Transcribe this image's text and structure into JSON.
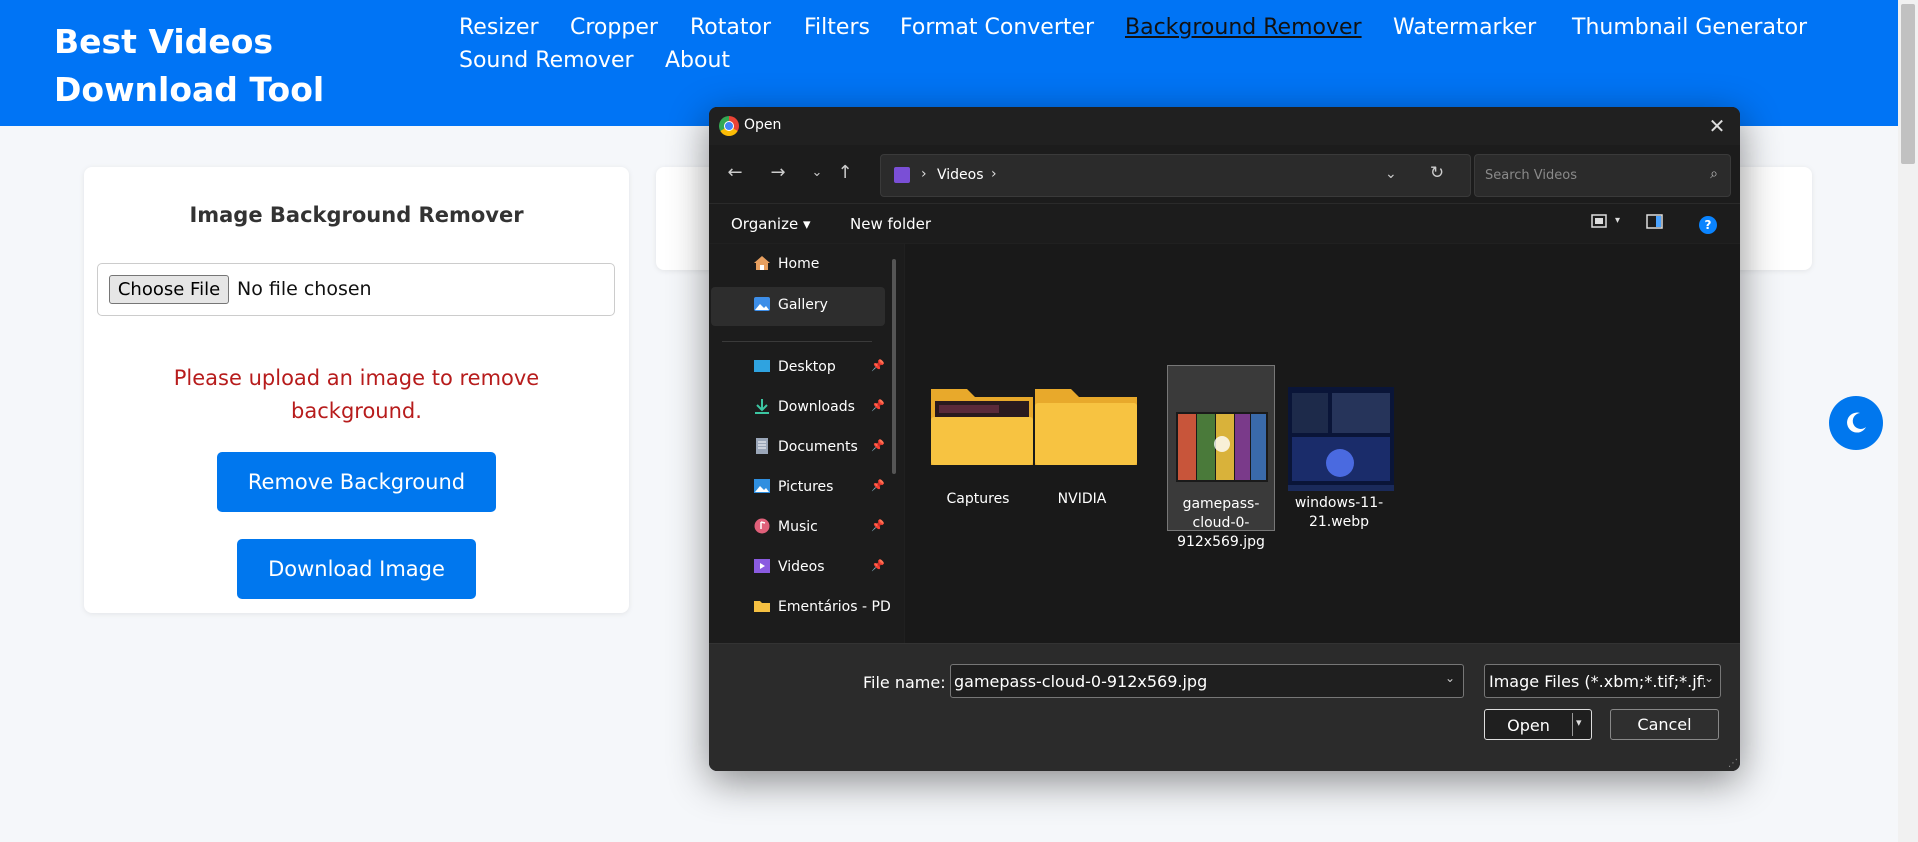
{
  "header": {
    "brand": "Best Videos Download Tool",
    "nav": [
      {
        "label": "Resizer",
        "active": false
      },
      {
        "label": "Cropper",
        "active": false
      },
      {
        "label": "Rotator",
        "active": false
      },
      {
        "label": "Filters",
        "active": false
      },
      {
        "label": "Format Converter",
        "active": false
      },
      {
        "label": "Background Remover",
        "active": true
      },
      {
        "label": "Watermarker",
        "active": false
      },
      {
        "label": "Thumbnail Generator",
        "active": false
      },
      {
        "label": "Sound Remover",
        "active": false
      },
      {
        "label": "About",
        "active": false
      }
    ]
  },
  "card": {
    "title": "Image Background Remover",
    "choose_file": "Choose File",
    "no_file": "No file chosen",
    "warning": "Please upload an image to remove background.",
    "remove_btn": "Remove Background",
    "download_btn": "Download Image"
  },
  "dialog": {
    "title": "Open",
    "breadcrumb": {
      "sep1": "›",
      "folder": "Videos",
      "sep2": "›"
    },
    "search_placeholder": "Search Videos",
    "organize": "Organize ▾",
    "new_folder": "New folder",
    "sidebar": [
      {
        "label": "Home",
        "pinned": false,
        "selected": false,
        "icon": "home-icon"
      },
      {
        "label": "Gallery",
        "pinned": false,
        "selected": true,
        "icon": "gallery-icon"
      },
      {
        "label": "Desktop",
        "pinned": true,
        "selected": false,
        "icon": "desktop-icon"
      },
      {
        "label": "Downloads",
        "pinned": true,
        "selected": false,
        "icon": "download-icon"
      },
      {
        "label": "Documents",
        "pinned": true,
        "selected": false,
        "icon": "document-icon"
      },
      {
        "label": "Pictures",
        "pinned": true,
        "selected": false,
        "icon": "pictures-icon"
      },
      {
        "label": "Music",
        "pinned": true,
        "selected": false,
        "icon": "music-icon"
      },
      {
        "label": "Videos",
        "pinned": true,
        "selected": false,
        "icon": "videos-icon"
      },
      {
        "label": "Ementários - PD",
        "pinned": false,
        "selected": false,
        "icon": "folder-icon"
      }
    ],
    "files": [
      {
        "label": "Captures",
        "type": "folder"
      },
      {
        "label": "NVIDIA",
        "type": "folder"
      },
      {
        "label": "gamepass-cloud-0-912x569.jpg",
        "type": "image",
        "selected": true
      },
      {
        "label": "windows-11-21.webp",
        "type": "image",
        "selected": false
      }
    ],
    "file_name_label": "File name:",
    "file_name_value": "gamepass-cloud-0-912x569.jpg",
    "filter_value": "Image Files (*.xbm;*.tif;*.jfi",
    "open_btn": "Open",
    "cancel_btn": "Cancel"
  },
  "colors": {
    "header_bg": "#0074f5",
    "accent": "#0077ee",
    "warning": "#b71c1c",
    "dialog_bg": "#202020"
  }
}
